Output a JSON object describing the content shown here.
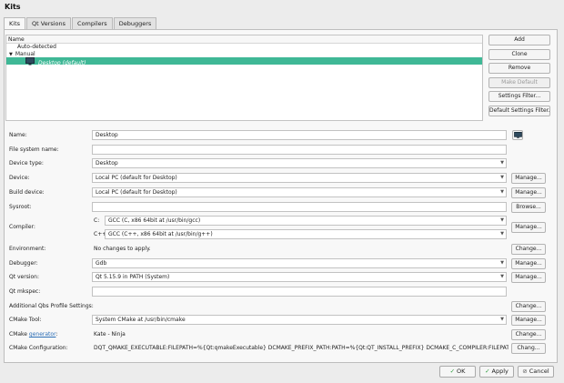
{
  "title": "Kits",
  "tabs": [
    "Kits",
    "Qt Versions",
    "Compilers",
    "Debuggers"
  ],
  "tree": {
    "header": "Name",
    "rows": [
      "Auto-detected",
      "Manual",
      "Desktop (default)"
    ]
  },
  "side_buttons": {
    "add": "Add",
    "clone": "Clone",
    "remove": "Remove",
    "make_default": "Make Default",
    "settings_filter": "Settings Filter...",
    "default_settings_filter": "Default Settings Filter..."
  },
  "form": {
    "name_label": "Name:",
    "name_value": "Desktop",
    "fs_name_label": "File system name:",
    "fs_name_value": "",
    "device_type_label": "Device type:",
    "device_type_value": "Desktop",
    "device_label": "Device:",
    "device_value": "Local PC (default for Desktop)",
    "build_device_label": "Build device:",
    "build_device_value": "Local PC (default for Desktop)",
    "sysroot_label": "Sysroot:",
    "sysroot_value": "",
    "compiler_label": "Compiler:",
    "compiler_c_label": "C:",
    "compiler_c_value": "GCC (C, x86 64bit at /usr/bin/gcc)",
    "compiler_cpp_label": "C++:",
    "compiler_cpp_value": "GCC (C++, x86 64bit at /usr/bin/g++)",
    "environment_label": "Environment:",
    "environment_value": "No changes to apply.",
    "debugger_label": "Debugger:",
    "debugger_value": "Gdb",
    "qt_version_label": "Qt version:",
    "qt_version_value": "Qt 5.15.9 in PATH (System)",
    "qt_mkspec_label": "Qt mkspec:",
    "qt_mkspec_value": "",
    "qbs_label": "Additional Qbs Profile Settings:",
    "cmake_tool_label": "CMake Tool:",
    "cmake_tool_value": "System CMake at /usr/bin/cmake",
    "cmake_gen_label_prefix": "CMake ",
    "cmake_gen_label_link": "generator",
    "cmake_gen_label_suffix": ":",
    "cmake_gen_value": "Kate - Ninja",
    "cmake_config_label": "CMake Configuration:",
    "cmake_config_value": "DQT_QMAKE_EXECUTABLE:FILEPATH=%{Qt:qmakeExecutable}  DCMAKE_PREFIX_PATH:PATH=%{Qt:QT_INSTALL_PREFIX}  DCMAKE_C_COMPILER:FILEPATH=%{Co..."
  },
  "row_buttons": {
    "manage": "Manage...",
    "browse": "Browse...",
    "change": "Change...",
    "change_short": "Chang..."
  },
  "dialog_buttons": {
    "ok": "OK",
    "apply": "Apply",
    "cancel": "Cancel"
  },
  "colors": {
    "selection": "#3fb896",
    "link": "#2a6db5"
  }
}
